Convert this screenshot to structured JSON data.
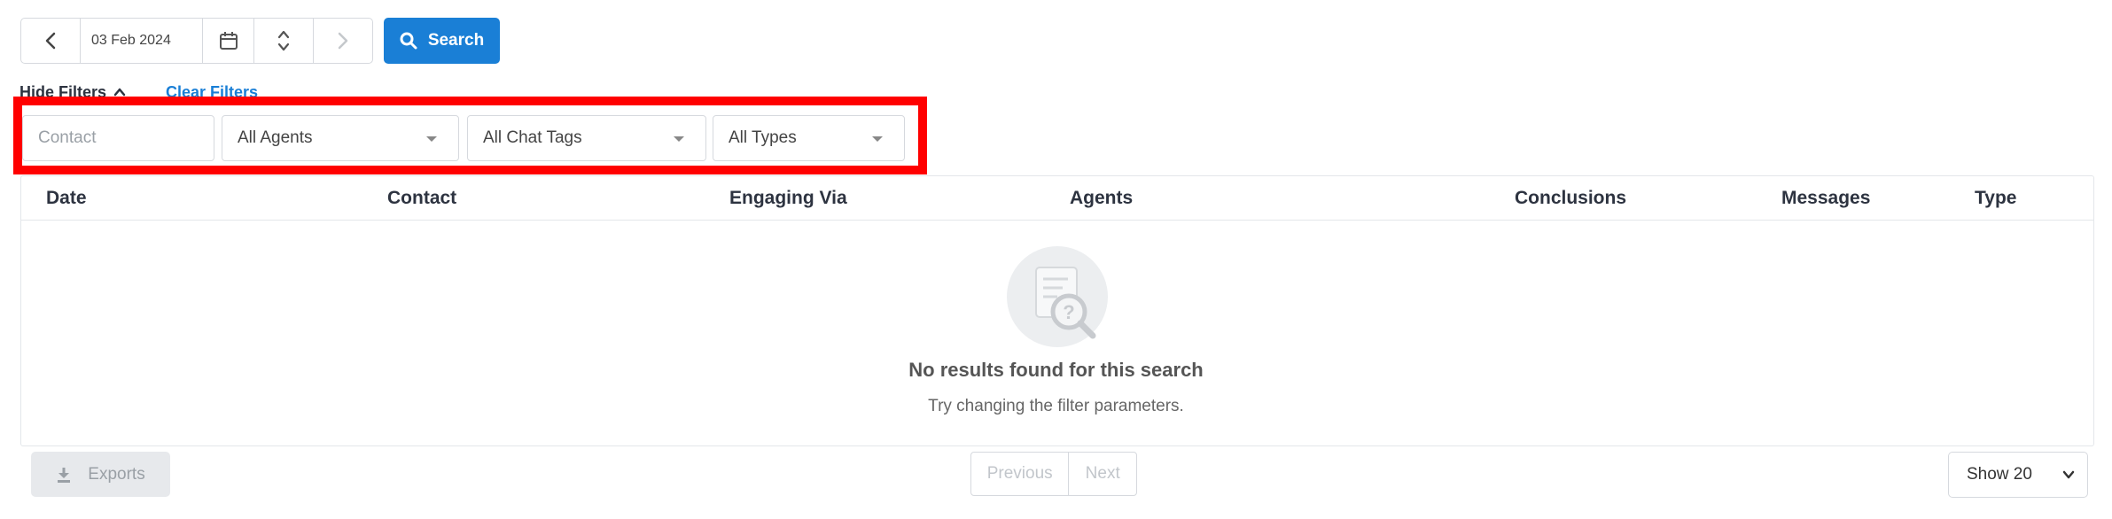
{
  "toolbar": {
    "date_value": "03 Feb 2024",
    "search_label": "Search",
    "accent_color": "#1a7fd6"
  },
  "filters": {
    "hide_label": "Hide Filters",
    "clear_label": "Clear Filters",
    "contact_placeholder": "Contact",
    "agents_selected": "All Agents",
    "chat_tags_selected": "All Chat Tags",
    "types_selected": "All Types",
    "highlight_color": "#ff0000"
  },
  "table": {
    "columns": [
      "Date",
      "Contact",
      "Engaging Via",
      "Agents",
      "Conclusions",
      "Messages",
      "Type"
    ],
    "empty_title": "No results found for this search",
    "empty_subtitle": "Try changing the filter parameters."
  },
  "footer": {
    "exports_label": "Exports",
    "previous_label": "Previous",
    "next_label": "Next",
    "page_size_label": "Show 20"
  },
  "icons": [
    "chevron-left-icon",
    "calendar-icon",
    "up-down-spinner-icon",
    "chevron-right-icon",
    "search-icon",
    "chevron-up-icon",
    "dropdown-caret-icon",
    "no-results-icon",
    "download-icon",
    "chevron-down-icon"
  ]
}
